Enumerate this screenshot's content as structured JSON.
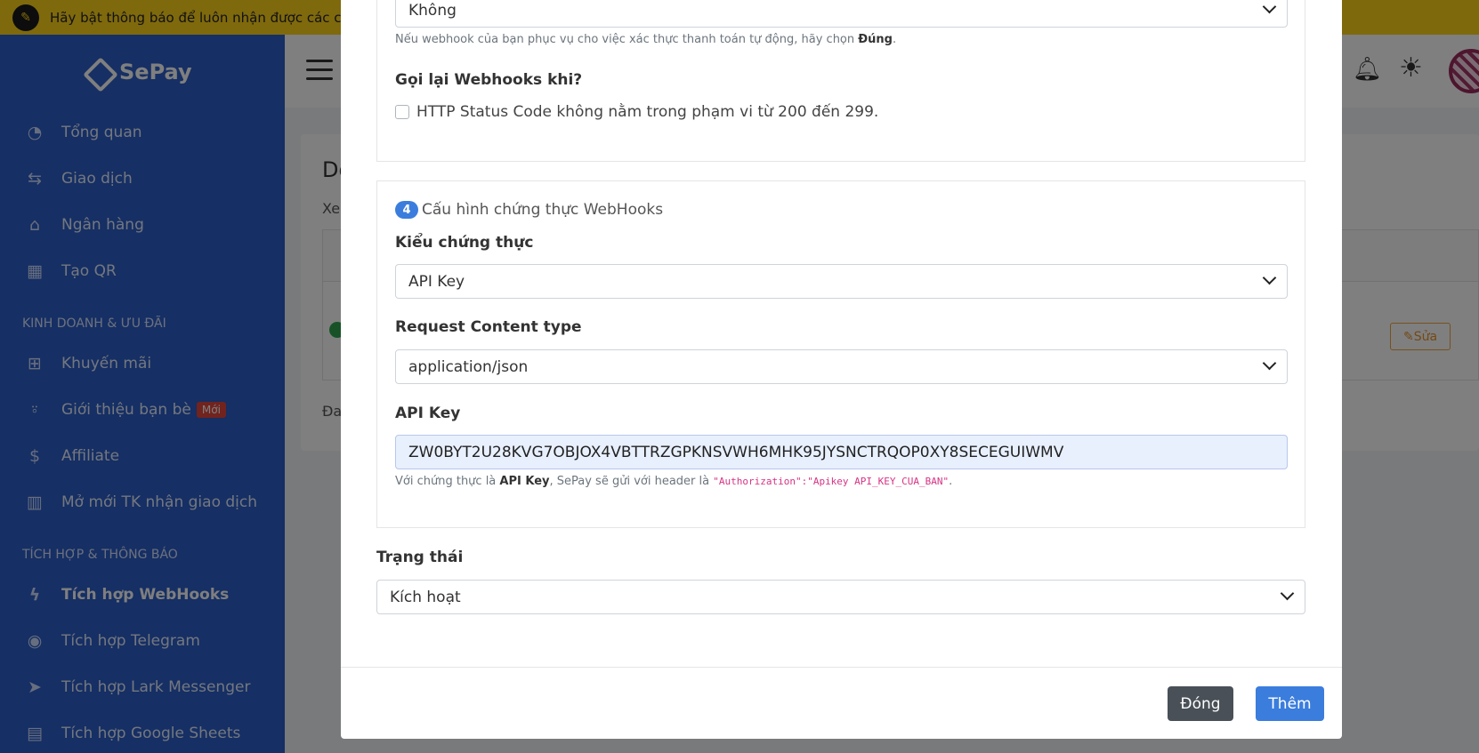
{
  "notification": {
    "icon": "bell-off-icon",
    "text": "Hãy bật thông báo để luôn nhận được các c"
  },
  "sidebar": {
    "brand": "SePay",
    "items": [
      {
        "label": "Tổng quan",
        "icon": "dashboard-icon"
      },
      {
        "label": "Giao dịch",
        "icon": "transfer-icon"
      },
      {
        "label": "Ngân hàng",
        "icon": "bank-icon"
      },
      {
        "label": "Tạo QR",
        "icon": "qr-icon"
      }
    ],
    "section_business": "KINH DOANH & ƯU ĐÃI",
    "business_items": [
      {
        "label": "Khuyến mãi",
        "icon": "gift-icon"
      },
      {
        "label": "Giới thiệu bạn bè",
        "icon": "add-user-icon",
        "badge": "Mới"
      },
      {
        "label": "Affiliate",
        "icon": "dollar-icon"
      },
      {
        "label": "Mở mới TK nhận giao dịch",
        "icon": "building-icon"
      }
    ],
    "section_integration": "TÍCH HỢP & THÔNG BÁO",
    "integration_items": [
      {
        "label": "Tích hợp WebHooks",
        "icon": "lightning-icon"
      },
      {
        "label": "Tích hợp Telegram",
        "icon": "telegram-icon"
      },
      {
        "label": "Tích hợp Lark Messenger",
        "icon": "send-icon"
      },
      {
        "label": "Tích hợp Google Sheets",
        "icon": "sheet-icon"
      }
    ]
  },
  "background": {
    "title": "Do",
    "subtitle": "Xe",
    "footer": "Đa",
    "edit_label": "Sửa"
  },
  "modal": {
    "verify_select_value": "Không",
    "verify_help_prefix": "Nếu webhook của bạn phục vụ cho việc xác thực thanh toán tự động, hãy chọn ",
    "verify_help_bold": "Đúng",
    "verify_help_suffix": ".",
    "retry_label": "Gọi lại Webhooks khi?",
    "retry_checkbox_label": "HTTP Status Code không nằm trong phạm vi từ 200 đến 299.",
    "retry_checked": false,
    "section4_number": "4",
    "section4_title": "Cấu hình chứng thực WebHooks",
    "auth_type_label": "Kiểu chứng thực",
    "auth_type_value": "API Key",
    "content_type_label": "Request Content type",
    "content_type_value": "application/json",
    "api_key_label": "API Key",
    "api_key_value": "ZW0BYT2U28KVG7OBJOX4VBTTRZGPKNSVWH6MHK95JYSNCTRQOP0XY8SECEGUIWMV",
    "api_help_prefix": "Với chứng thực là ",
    "api_help_bold": "API Key",
    "api_help_middle": ", SePay sẽ gửi với header là ",
    "api_help_code": "\"Authorization\":\"Apikey API_KEY_CUA_BAN\"",
    "api_help_suffix": ".",
    "status_label": "Trạng thái",
    "status_value": "Kích hoạt",
    "close_button": "Đóng",
    "add_button": "Thêm"
  }
}
